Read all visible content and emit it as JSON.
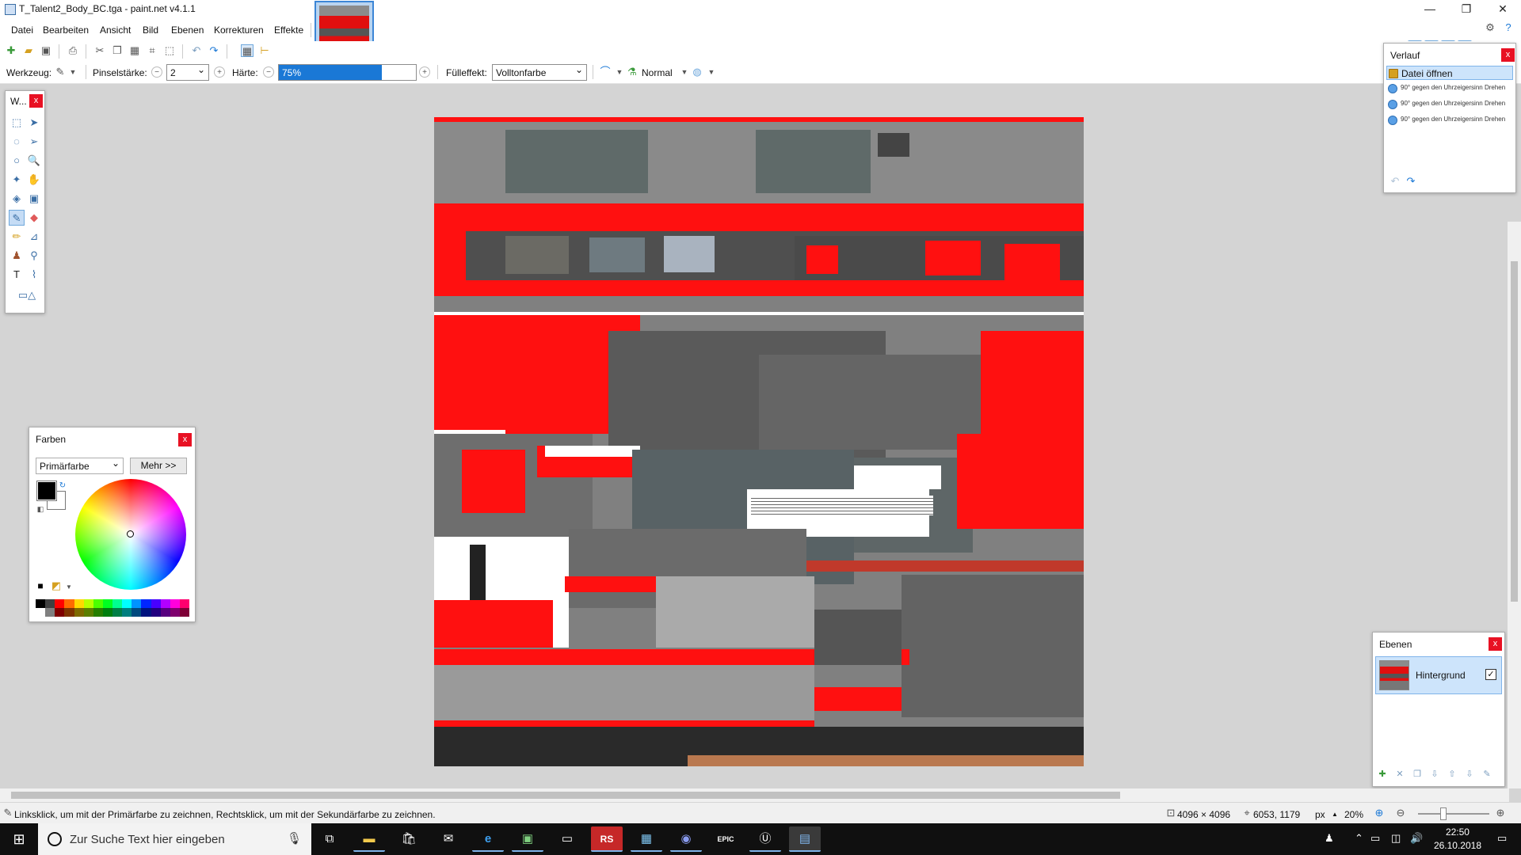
{
  "window": {
    "title": "T_Talent2_Body_BC.tga - paint.net v4.1.1",
    "controls": [
      "—",
      "❐",
      "✕"
    ]
  },
  "menu": {
    "items": [
      "Datei",
      "Bearbeiten",
      "Ansicht",
      "Bild",
      "Ebenen",
      "Korrekturen",
      "Effekte"
    ]
  },
  "toolbar": {
    "tool_label": "Werkzeug:",
    "brush_label": "Pinselstärke:",
    "brush_value": "2",
    "hardness_label": "Härte:",
    "hardness_value": "75%",
    "hardness_fraction": 0.75,
    "fill_label": "Fülleffekt:",
    "fill_value": "Volltonfarbe",
    "blend_value": "Normal"
  },
  "tools_panel": {
    "title": "W...",
    "close": "x"
  },
  "colors_panel": {
    "title": "Farben",
    "close": "x",
    "select_value": "Primärfarbe",
    "more_label": "Mehr >>",
    "primary_color": "#000000",
    "secondary_color": "#ffffff",
    "palette": [
      "#000000",
      "#404040",
      "#ff0000",
      "#ff6a00",
      "#ffd800",
      "#b6ff00",
      "#4cff00",
      "#00ff21",
      "#00ff90",
      "#00ffff",
      "#0094ff",
      "#0026ff",
      "#4800ff",
      "#b200ff",
      "#ff00dc",
      "#ff006e",
      "#ffffff",
      "#808080",
      "#7f0000",
      "#7f3300",
      "#7f6a00",
      "#5b7f00",
      "#267f00",
      "#007f0e",
      "#007f46",
      "#007f7f",
      "#004a7f",
      "#00137f",
      "#21007f",
      "#57007f",
      "#7f006e",
      "#7f0037"
    ]
  },
  "history_panel": {
    "title": "Verlauf",
    "close": "x",
    "items": [
      "Datei öffnen",
      "90° gegen den Uhrzeigersinn Drehen",
      "90° gegen den Uhrzeigersinn Drehen",
      "90° gegen den Uhrzeigersinn Drehen"
    ]
  },
  "layers_panel": {
    "title": "Ebenen",
    "close": "x",
    "layer_name": "Hintergrund",
    "layer_visible": "✓"
  },
  "statusbar": {
    "hint": "Linksklick, um mit der Primärfarbe zu zeichnen, Rechtsklick, um mit der Sekundärfarbe zu zeichnen.",
    "image_size": "4096 × 4096",
    "cursor_pos": "6053, 1179",
    "unit": "px",
    "zoom": "20%"
  },
  "taskbar": {
    "search_placeholder": "Zur Suche Text hier eingeben",
    "time": "22:50",
    "date": "26.10.2018"
  },
  "colors": {
    "accent": "#1a78d6",
    "texture_red": "#ff1010",
    "texture_gray": "#808080"
  }
}
